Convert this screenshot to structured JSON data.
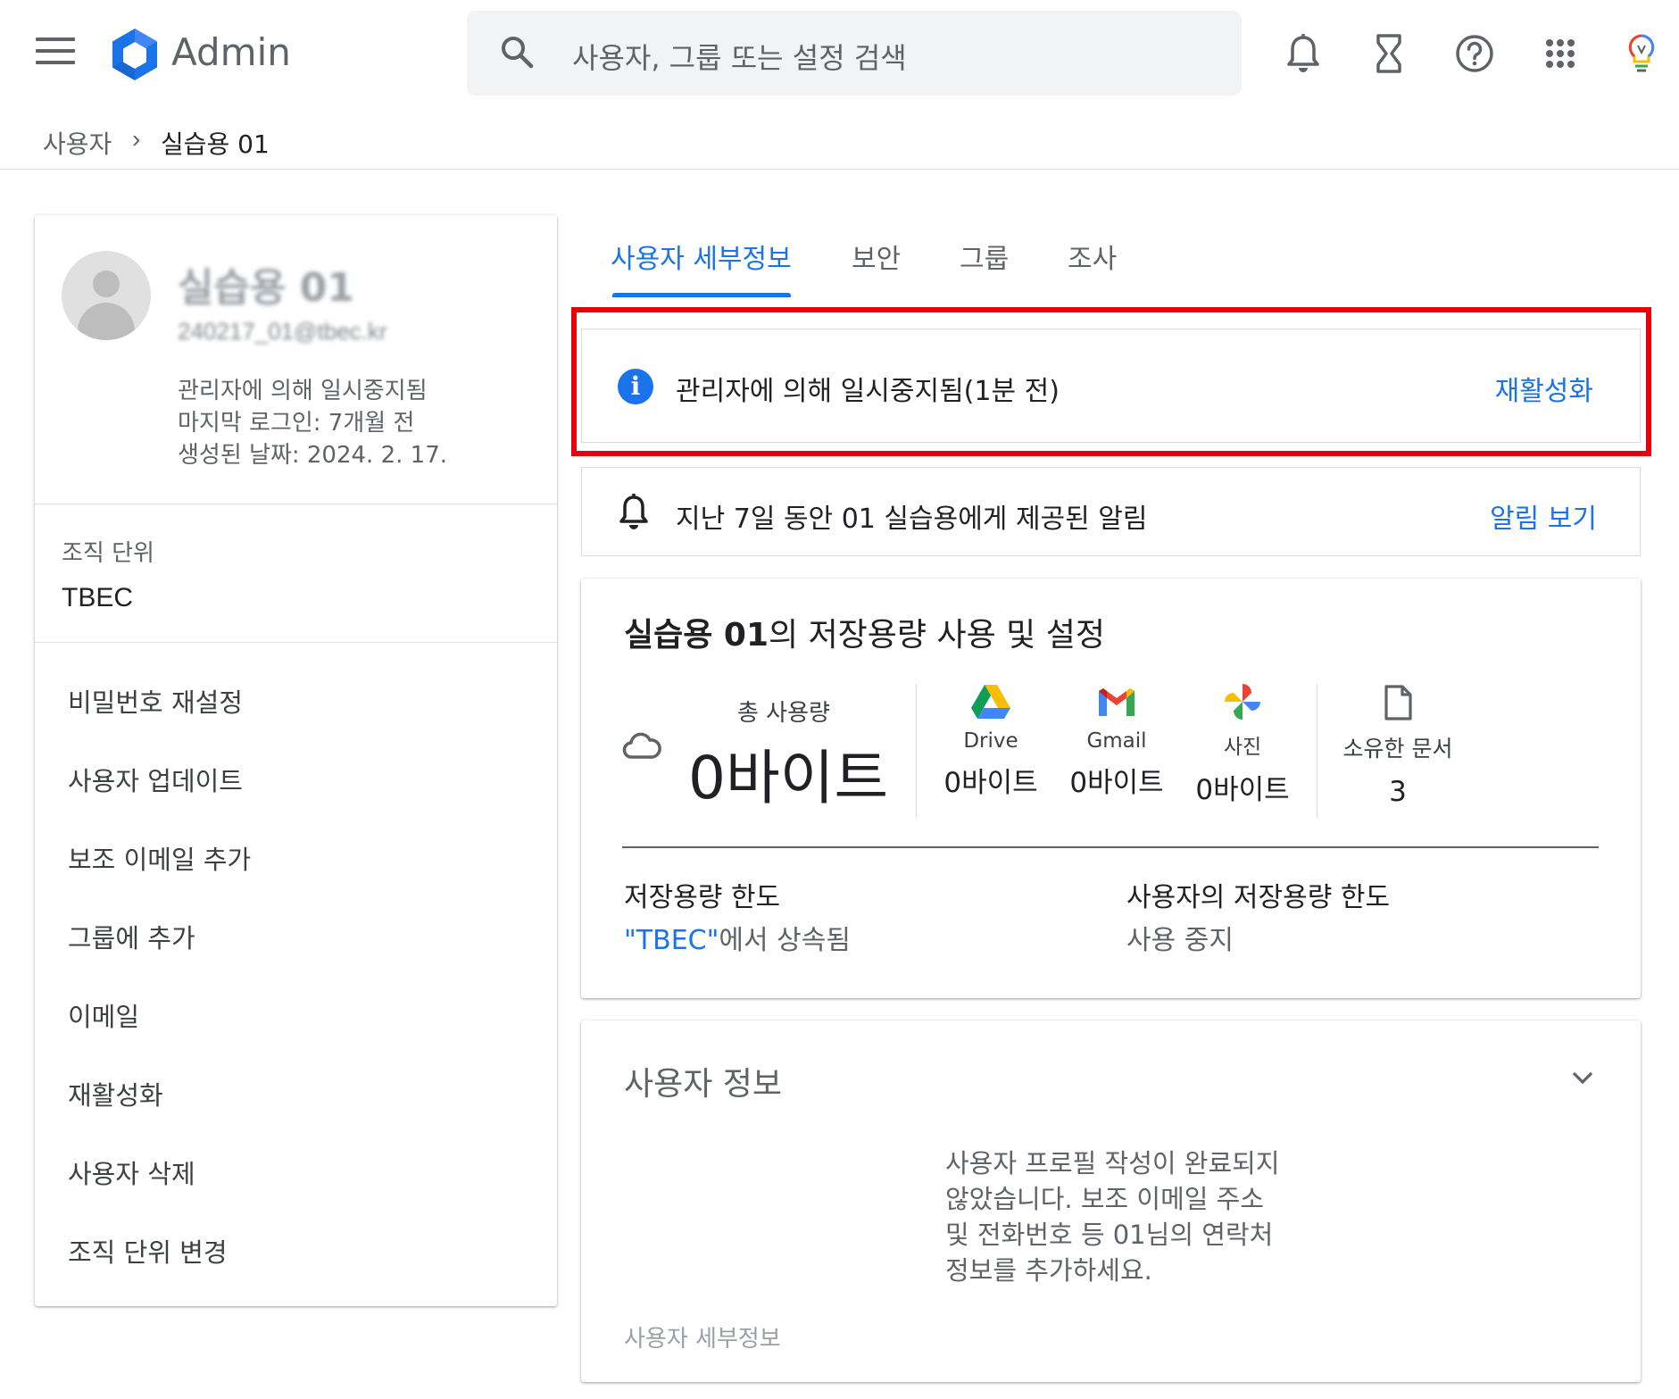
{
  "app": {
    "name": "Admin"
  },
  "search": {
    "placeholder": "사용자, 그룹 또는 설정 검색"
  },
  "toolbar_icons": [
    "bell-icon",
    "hourglass-icon",
    "help-icon",
    "apps-grid-icon",
    "lightbulb-icon"
  ],
  "breadcrumb": {
    "parent": "사용자",
    "separator": "›",
    "current": "실습용 01"
  },
  "user_card": {
    "name": "실습용 01",
    "email": "240217_01@tbec.kr",
    "status": "관리자에 의해 일시중지됨",
    "last_login": "마지막 로그인: 7개월 전",
    "created": "생성된 날짜: 2024. 2. 17.",
    "org_unit_label": "조직 단위",
    "org_unit_value": "TBEC",
    "actions": [
      "비밀번호 재설정",
      "사용자 업데이트",
      "보조 이메일 추가",
      "그룹에 추가",
      "이메일",
      "재활성화",
      "사용자 삭제",
      "조직 단위 변경"
    ]
  },
  "tabs": [
    {
      "label": "사용자 세부정보",
      "active": true
    },
    {
      "label": "보안",
      "active": false
    },
    {
      "label": "그룹",
      "active": false
    },
    {
      "label": "조사",
      "active": false
    }
  ],
  "suspend_banner": {
    "text": "관리자에 의해 일시중지됨(1분 전)",
    "action": "재활성화"
  },
  "alert_banner": {
    "text": "지난 7일 동안 01 실습용에게 제공된 알림",
    "action": "알림 보기"
  },
  "storage": {
    "title_user": "실습용 01",
    "title_rest": "의 저장용량 사용 및 설정",
    "total_label": "총 사용량",
    "total_value": "0바이트",
    "services": [
      {
        "name": "Drive",
        "value": "0바이트",
        "icon": "drive-icon"
      },
      {
        "name": "Gmail",
        "value": "0바이트",
        "icon": "gmail-icon"
      },
      {
        "name": "사진",
        "value": "0바이트",
        "icon": "photos-icon"
      }
    ],
    "owned_docs_label": "소유한 문서",
    "owned_docs_value": "3",
    "quota_label": "저장용량 한도",
    "quota_link": "\"TBEC\"",
    "quota_suffix": "에서 상속됨",
    "user_quota_label": "사용자의 저장용량 한도",
    "user_quota_value": "사용 중지"
  },
  "user_info": {
    "title": "사용자 정보",
    "message": "사용자 프로필 작성이 완료되지 않았습니다. 보조 이메일 주소 및 전화번호 등 01님의 연락처 정보를 추가하세요.",
    "footer": "사용자 세부정보"
  }
}
